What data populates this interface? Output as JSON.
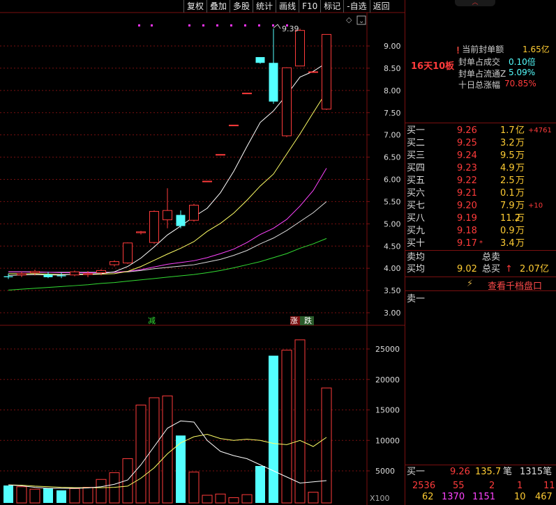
{
  "toolbar": {
    "items": [
      "复权",
      "叠加",
      "多股",
      "统计",
      "画线",
      "F10",
      "标记",
      "-自选",
      "返回"
    ]
  },
  "price_chart": {
    "high_label": "9.39",
    "signals": [
      "减",
      "涨",
      "跌"
    ],
    "y_ticks": [
      "9.00",
      "8.50",
      "8.00",
      "7.50",
      "7.00",
      "6.50",
      "6.00",
      "5.50",
      "5.00",
      "4.50",
      "4.00",
      "3.50",
      "3.00"
    ]
  },
  "volume_chart": {
    "y_ticks": [
      "25000",
      "20000",
      "15000",
      "10000",
      "5000"
    ],
    "unit": "X100"
  },
  "colors": {
    "up": "#ff3b3b",
    "down": "#54ffff",
    "ma5": "#ffffff",
    "ma10": "#ffff66",
    "ma20": "#ff44ff",
    "ma30": "#dddddd",
    "ma60": "#33dd33",
    "grid": "#7a1010"
  },
  "chart_data": [
    {
      "type": "candlestick",
      "title": "",
      "ylim": [
        2.8,
        9.5
      ],
      "candles": [
        {
          "o": 3.82,
          "h": 3.88,
          "l": 3.76,
          "c": 3.8
        },
        {
          "o": 3.85,
          "h": 3.92,
          "l": 3.8,
          "c": 3.88
        },
        {
          "o": 3.9,
          "h": 3.97,
          "l": 3.84,
          "c": 3.93
        },
        {
          "o": 3.86,
          "h": 3.92,
          "l": 3.78,
          "c": 3.8
        },
        {
          "o": 3.84,
          "h": 3.9,
          "l": 3.78,
          "c": 3.82
        },
        {
          "o": 3.85,
          "h": 3.95,
          "l": 3.82,
          "c": 3.92
        },
        {
          "o": 3.86,
          "h": 3.94,
          "l": 3.8,
          "c": 3.88
        },
        {
          "o": 3.9,
          "h": 3.98,
          "l": 3.84,
          "c": 3.95
        },
        {
          "o": 4.08,
          "h": 4.18,
          "l": 4.04,
          "c": 4.15
        },
        {
          "o": 4.12,
          "h": 4.58,
          "l": 4.1,
          "c": 4.57
        },
        {
          "o": 4.8,
          "h": 4.84,
          "l": 4.76,
          "c": 4.82
        },
        {
          "o": 4.58,
          "h": 5.3,
          "l": 4.55,
          "c": 5.28
        },
        {
          "o": 5.09,
          "h": 5.8,
          "l": 4.9,
          "c": 5.3
        },
        {
          "o": 5.2,
          "h": 5.3,
          "l": 4.9,
          "c": 4.95
        },
        {
          "o": 5.08,
          "h": 5.45,
          "l": 5.05,
          "c": 5.42
        },
        {
          "o": 5.96,
          "h": 5.96,
          "l": 5.96,
          "c": 5.96
        },
        {
          "o": 6.56,
          "h": 6.56,
          "l": 6.56,
          "c": 6.56
        },
        {
          "o": 7.22,
          "h": 7.22,
          "l": 7.22,
          "c": 7.22
        },
        {
          "o": 7.94,
          "h": 7.94,
          "l": 7.94,
          "c": 7.94
        },
        {
          "o": 8.75,
          "h": 8.75,
          "l": 8.6,
          "c": 8.62
        },
        {
          "o": 8.62,
          "h": 9.39,
          "l": 7.7,
          "c": 7.75
        },
        {
          "o": 6.98,
          "h": 8.52,
          "l": 6.95,
          "c": 8.51
        },
        {
          "o": 8.55,
          "h": 9.39,
          "l": 8.55,
          "c": 9.35
        },
        {
          "o": 8.42,
          "h": 8.42,
          "l": 8.42,
          "c": 8.42
        },
        {
          "o": 7.58,
          "h": 9.26,
          "l": 7.56,
          "c": 9.26
        }
      ],
      "ma5": [
        3.84,
        3.85,
        3.86,
        3.85,
        3.85,
        3.87,
        3.87,
        3.88,
        3.92,
        4.04,
        4.23,
        4.48,
        4.75,
        4.95,
        5.16,
        5.35,
        5.7,
        6.18,
        6.74,
        7.28,
        7.54,
        7.9,
        8.3,
        8.43,
        8.62
      ],
      "ma10": [
        3.88,
        3.88,
        3.88,
        3.87,
        3.86,
        3.86,
        3.86,
        3.87,
        3.88,
        3.93,
        4.04,
        4.18,
        4.32,
        4.45,
        4.6,
        4.83,
        5.01,
        5.24,
        5.53,
        5.85,
        6.12,
        6.57,
        7.02,
        7.5,
        7.97
      ],
      "ma20": [
        3.92,
        3.92,
        3.91,
        3.91,
        3.9,
        3.9,
        3.9,
        3.9,
        3.91,
        3.93,
        3.97,
        4.03,
        4.09,
        4.13,
        4.17,
        4.24,
        4.33,
        4.43,
        4.58,
        4.76,
        4.9,
        5.1,
        5.4,
        5.75,
        6.25
      ],
      "ma30": [
        3.92,
        3.92,
        3.92,
        3.91,
        3.91,
        3.91,
        3.91,
        3.91,
        3.91,
        3.92,
        3.95,
        3.99,
        4.02,
        4.05,
        4.08,
        4.14,
        4.2,
        4.29,
        4.4,
        4.55,
        4.68,
        4.85,
        5.05,
        5.25,
        5.5
      ],
      "ma60": [
        3.51,
        3.53,
        3.55,
        3.57,
        3.59,
        3.61,
        3.63,
        3.66,
        3.68,
        3.71,
        3.74,
        3.77,
        3.8,
        3.83,
        3.86,
        3.9,
        3.95,
        4.01,
        4.08,
        4.15,
        4.24,
        4.33,
        4.45,
        4.55,
        4.67
      ]
    },
    {
      "type": "bar",
      "title": "",
      "ylim": [
        0,
        28000
      ],
      "values": [
        2600,
        2400,
        2000,
        2200,
        1800,
        2100,
        2300,
        3600,
        4700,
        7000,
        15800,
        17000,
        17300,
        10800,
        4800,
        1000,
        1200,
        600,
        1100,
        5800,
        23900,
        24800,
        26500,
        1500,
        18600
      ],
      "ma5": [
        2700,
        2550,
        2300,
        2150,
        2150,
        2150,
        2200,
        2400,
        2800,
        3500,
        6000,
        9000,
        12000,
        13200,
        13000,
        10000,
        8200,
        7500,
        7000,
        6000,
        5000,
        4000,
        3000,
        3200,
        3400
      ],
      "ma10": [
        2700,
        2650,
        2500,
        2400,
        2300,
        2250,
        2250,
        2250,
        2300,
        2500,
        3800,
        5500,
        7800,
        9600,
        10600,
        11000,
        10300,
        10000,
        10200,
        10000,
        9500,
        9300,
        10000,
        9000,
        10500
      ]
    }
  ],
  "summary": {
    "seal_amount_label": "当前封单额",
    "seal_amount_value": "1.65亿",
    "seal_turnover_label": "封单占成交",
    "seal_turnover_value": "0.10倍",
    "seal_float_label": "封单占流通Z",
    "seal_float_value": "5.09%",
    "ten_day_label": "十日总涨幅",
    "ten_day_value": "70.85%",
    "streak_label": "16天10板"
  },
  "order_book": [
    {
      "label": "买一",
      "price": "9.26",
      "vol": "1.7",
      "unit": "亿",
      "change": "+4761"
    },
    {
      "label": "买二",
      "price": "9.25",
      "vol": "3.2",
      "unit": "万",
      "change": ""
    },
    {
      "label": "买三",
      "price": "9.24",
      "vol": "9.5",
      "unit": "万",
      "change": ""
    },
    {
      "label": "买四",
      "price": "9.23",
      "vol": "4.9",
      "unit": "万",
      "change": ""
    },
    {
      "label": "买五",
      "price": "9.22",
      "vol": "2.5",
      "unit": "万",
      "change": ""
    },
    {
      "label": "买六",
      "price": "9.21",
      "vol": "0.1",
      "unit": "万",
      "change": ""
    },
    {
      "label": "买七",
      "price": "9.20",
      "vol": "7.9",
      "unit": "万",
      "change": "+10"
    },
    {
      "label": "买八",
      "price": "9.19",
      "vol": "11.2",
      "unit": "万",
      "change": ""
    },
    {
      "label": "买九",
      "price": "9.18",
      "vol": "0.9",
      "unit": "万",
      "change": ""
    },
    {
      "label": "买十",
      "price": "9.17",
      "vol": "3.4",
      "unit": "万",
      "change": ""
    }
  ],
  "order_book_mark": "*",
  "averages": {
    "sell_avg_label": "卖均",
    "sell_total_label": "总卖",
    "buy_avg_label": "买均",
    "buy_avg_value": "9.02",
    "buy_total_label": "总买",
    "buy_total_value": "2.07",
    "buy_total_unit": "亿"
  },
  "depth_link": "查看千档盘口",
  "sell_one_label": "卖一",
  "footer": {
    "label": "买一",
    "price": "9.26",
    "vol": "135.7",
    "unit": "笔",
    "count": "1315笔",
    "row1": [
      "2536",
      "55",
      "2",
      "1",
      "11"
    ],
    "row2": [
      "62",
      "1370",
      "1151",
      "10",
      "467"
    ]
  }
}
